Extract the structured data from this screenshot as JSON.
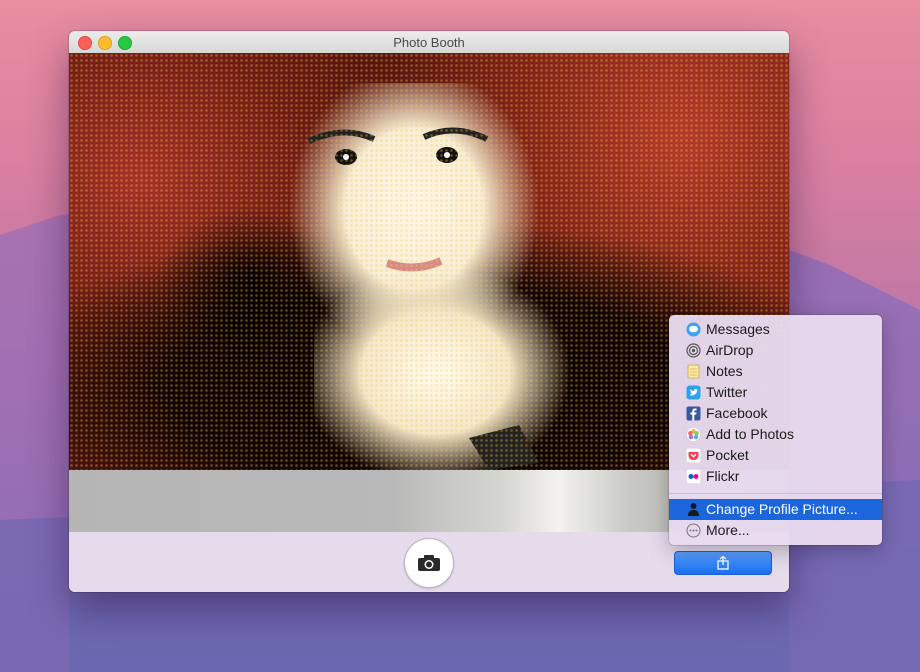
{
  "window": {
    "title": "Photo Booth"
  },
  "share_menu": {
    "items": [
      {
        "label": "Messages",
        "icon": "messages-icon"
      },
      {
        "label": "AirDrop",
        "icon": "airdrop-icon"
      },
      {
        "label": "Notes",
        "icon": "notes-icon"
      },
      {
        "label": "Twitter",
        "icon": "twitter-icon"
      },
      {
        "label": "Facebook",
        "icon": "facebook-icon"
      },
      {
        "label": "Add to Photos",
        "icon": "photos-icon"
      },
      {
        "label": "Pocket",
        "icon": "pocket-icon"
      },
      {
        "label": "Flickr",
        "icon": "flickr-icon"
      }
    ],
    "change_profile": {
      "label": "Change Profile Picture...",
      "icon": "person-icon",
      "selected": true
    },
    "more": {
      "label": "More...",
      "icon": "more-icon"
    }
  },
  "colors": {
    "accent": "#1b65dd",
    "share_button": "#2f7df5",
    "close": "#fc5f57",
    "minimize": "#fdbc2e",
    "zoom": "#28c840"
  }
}
